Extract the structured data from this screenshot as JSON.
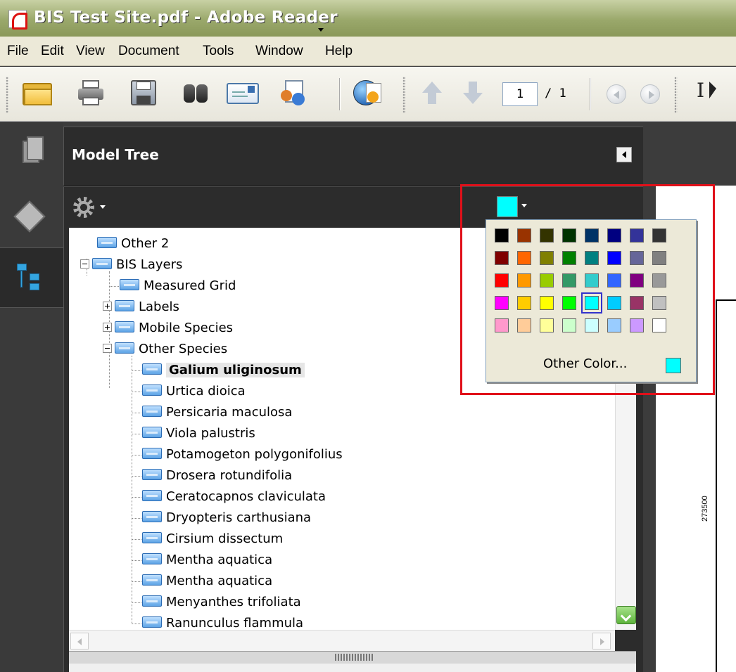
{
  "window": {
    "title": "BIS Test Site.pdf - Adobe Reader"
  },
  "menu": [
    "File",
    "Edit",
    "View",
    "Document",
    "Tools",
    "Window",
    "Help"
  ],
  "toolbar": {
    "page_current": "1",
    "page_total": "/ 1",
    "select_tool_label": "I"
  },
  "panel": {
    "title": "Model Tree",
    "selected_color": "#00ffff"
  },
  "tree": {
    "items": [
      {
        "label": "Other 2"
      },
      {
        "label": "BIS Layers"
      },
      {
        "label": "Measured Grid"
      },
      {
        "label": "Labels"
      },
      {
        "label": "Mobile Species"
      },
      {
        "label": "Other Species"
      },
      {
        "label": "Galium uliginosum"
      },
      {
        "label": "Urtica dioica"
      },
      {
        "label": "Persicaria maculosa"
      },
      {
        "label": "Viola palustris"
      },
      {
        "label": "Potamogeton polygonifolius"
      },
      {
        "label": "Drosera rotundifolia"
      },
      {
        "label": "Ceratocapnos claviculata"
      },
      {
        "label": "Dryopteris carthusiana"
      },
      {
        "label": "Cirsium dissectum"
      },
      {
        "label": "Mentha aquatica"
      },
      {
        "label": "Mentha aquatica"
      },
      {
        "label": "Menyanthes trifoliata"
      },
      {
        "label": "Ranunculus flammula"
      }
    ]
  },
  "color_popup": {
    "palette": [
      [
        "#000000",
        "#993300",
        "#333300",
        "#003300",
        "#003366",
        "#000080",
        "#333399",
        "#333333"
      ],
      [
        "#800000",
        "#ff6600",
        "#808000",
        "#008000",
        "#008080",
        "#0000ff",
        "#666699",
        "#808080"
      ],
      [
        "#ff0000",
        "#ff9900",
        "#99cc00",
        "#339966",
        "#33cccc",
        "#3366ff",
        "#800080",
        "#999999"
      ],
      [
        "#ff00ff",
        "#ffcc00",
        "#ffff00",
        "#00ff00",
        "#00ffff",
        "#00ccff",
        "#993366",
        "#c0c0c0"
      ],
      [
        "#ff99cc",
        "#ffcc99",
        "#ffff99",
        "#ccffcc",
        "#ccffff",
        "#99ccff",
        "#cc99ff",
        "#ffffff"
      ]
    ],
    "selected": "#00ffff",
    "other_color_label": "Other Color...",
    "other_color_value": "#00ffff"
  },
  "document": {
    "coordinate_label": "273500"
  }
}
